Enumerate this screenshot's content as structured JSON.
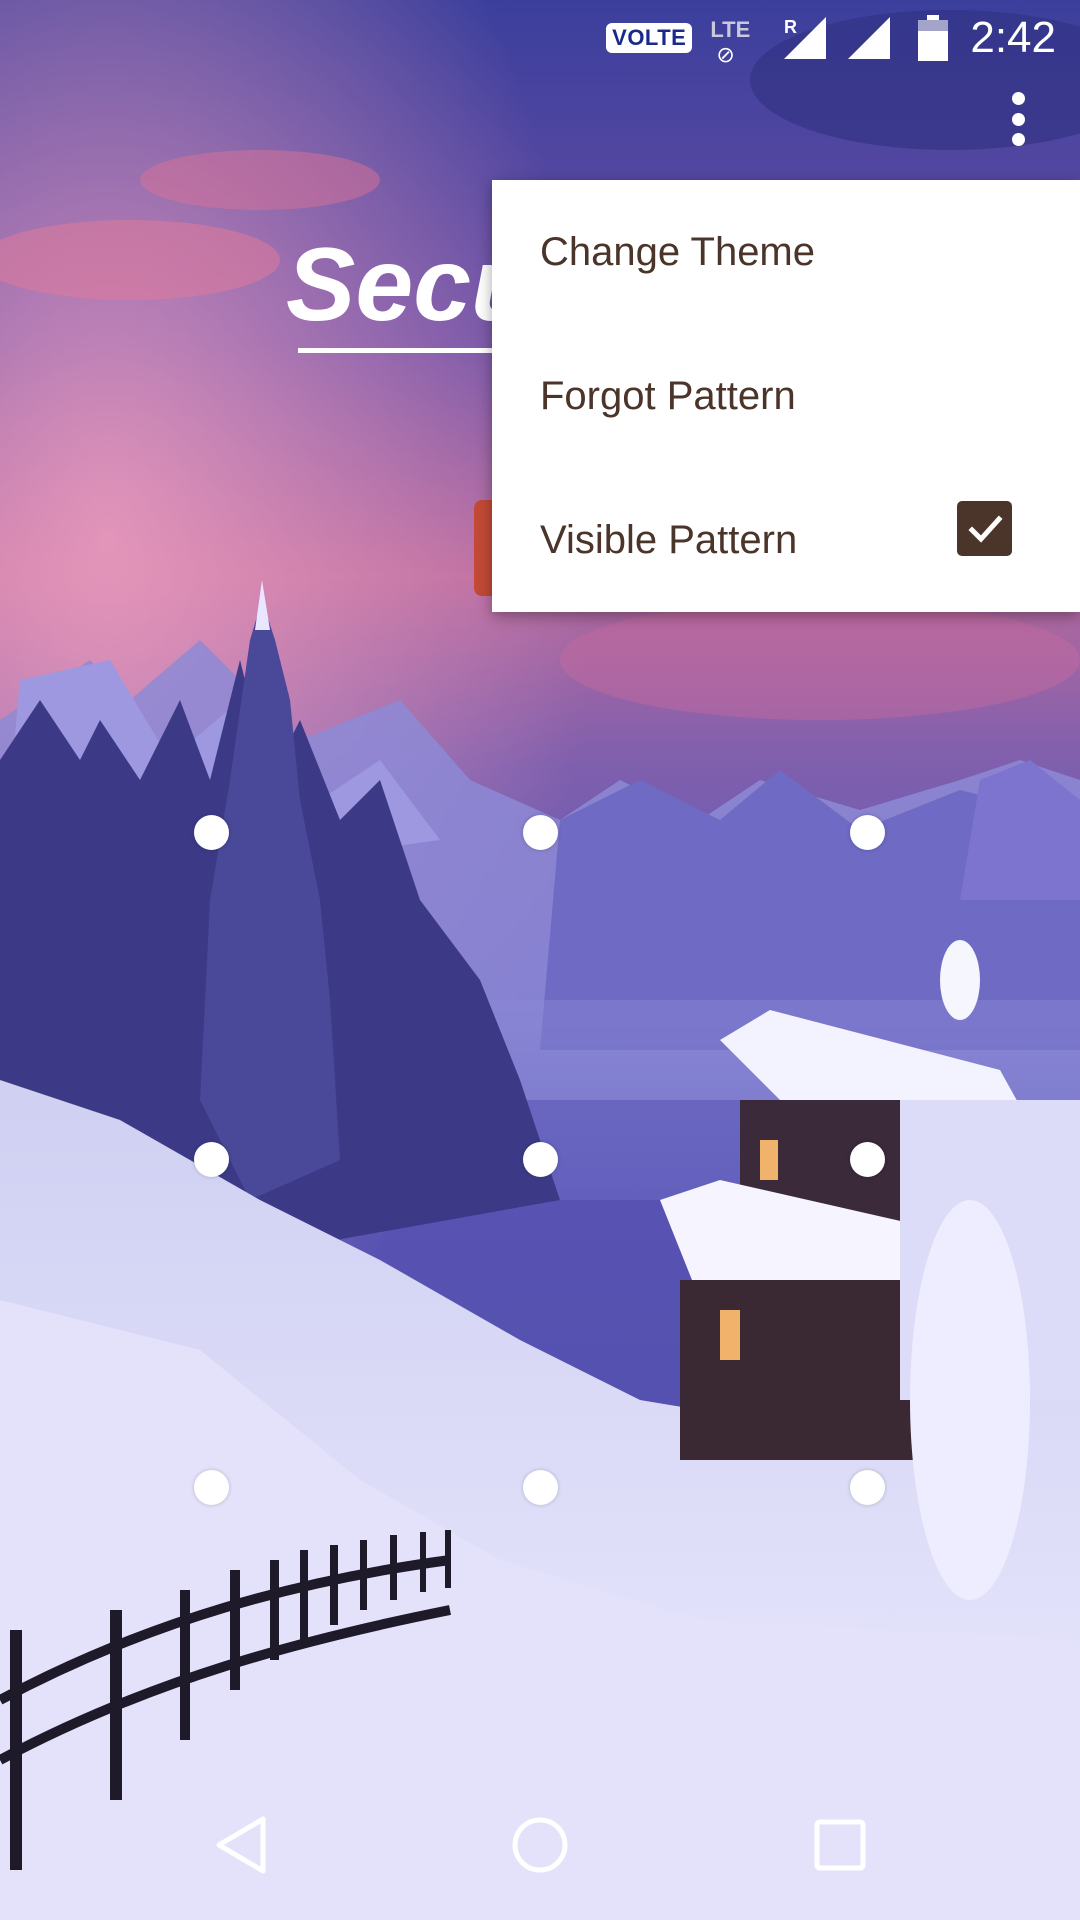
{
  "status_bar": {
    "volte": "VOLTE",
    "lte": "LTE",
    "roaming": "R",
    "time": "2:42"
  },
  "title": {
    "text": "Secu"
  },
  "menu": {
    "items": [
      {
        "label": "Change Theme"
      },
      {
        "label": "Forgot Pattern"
      },
      {
        "label": "Visible Pattern",
        "checked": true
      }
    ]
  },
  "pattern": {
    "rows": 3,
    "cols": 3
  },
  "icons": {
    "overflow": "more-vert-icon",
    "back": "back-triangle-icon",
    "home": "home-circle-icon",
    "recents": "recents-square-icon",
    "check": "check-icon"
  },
  "colors": {
    "menu_text": "#4b342a",
    "checkbox": "#4b342a",
    "accent_tab": "#c24a36"
  }
}
